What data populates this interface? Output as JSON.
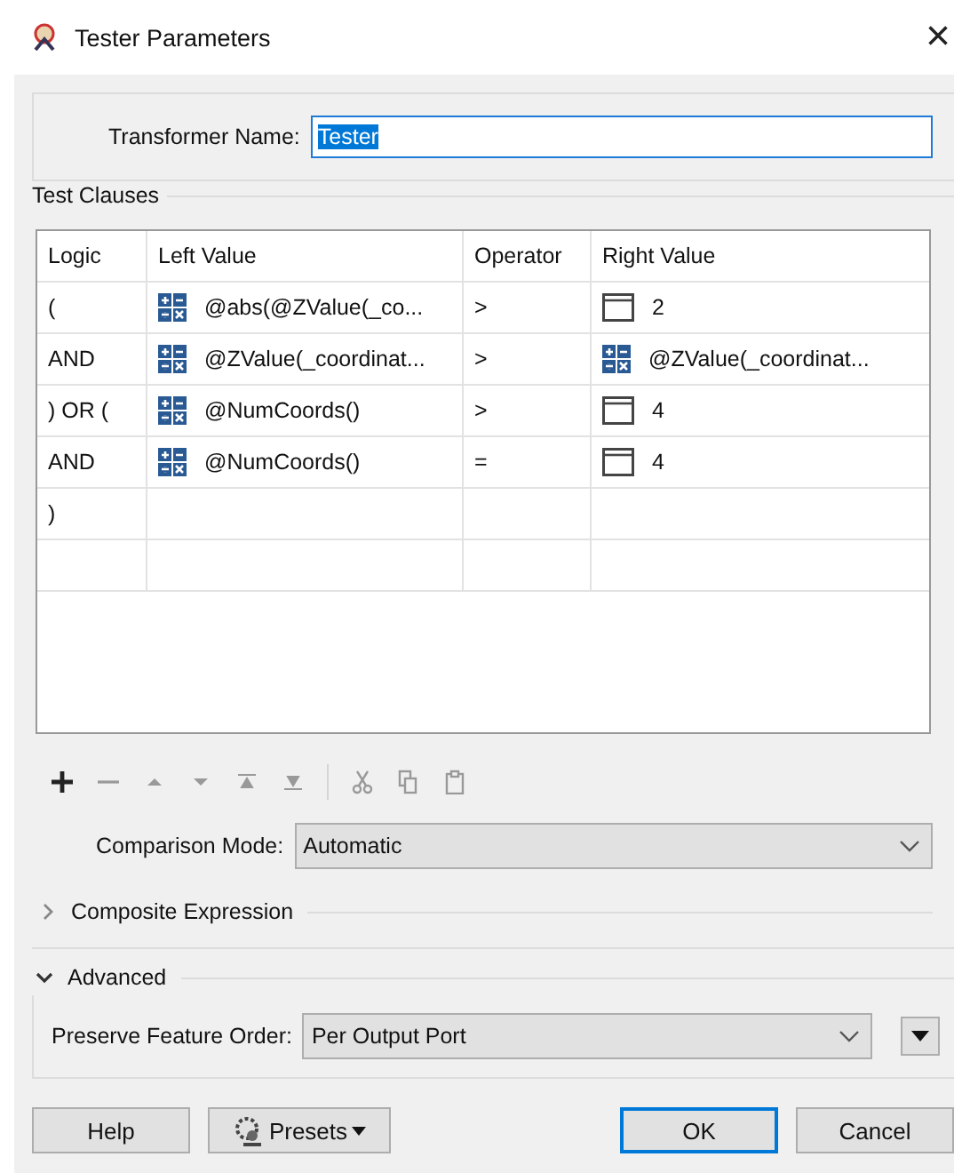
{
  "window": {
    "title": "Tester Parameters",
    "close": "×"
  },
  "transformer_name": {
    "label": "Transformer Name:",
    "value": "Tester",
    "text_selected": true
  },
  "test_clauses": {
    "title": "Test Clauses",
    "columns": [
      "Logic",
      "Left Value",
      "Operator",
      "Right Value"
    ],
    "rows": [
      {
        "logic": "(",
        "left": {
          "kind": "expression",
          "text": "@abs(@ZValue(_co..."
        },
        "operator": ">",
        "right": {
          "kind": "literal",
          "text": "2"
        }
      },
      {
        "logic": "AND",
        "left": {
          "kind": "expression",
          "text": "@ZValue(_coordinat..."
        },
        "operator": ">",
        "right": {
          "kind": "expression",
          "text": "@ZValue(_coordinat..."
        }
      },
      {
        "logic": ") OR (",
        "left": {
          "kind": "expression",
          "text": "@NumCoords()"
        },
        "operator": ">",
        "right": {
          "kind": "literal",
          "text": "4"
        }
      },
      {
        "logic": "AND",
        "left": {
          "kind": "expression",
          "text": "@NumCoords()"
        },
        "operator": "=",
        "right": {
          "kind": "literal",
          "text": "4"
        }
      },
      {
        "logic": ")"
      }
    ],
    "toolbar": [
      {
        "kind": "add",
        "disabled": false
      },
      {
        "kind": "remove",
        "disabled": true
      },
      {
        "kind": "up",
        "disabled": true
      },
      {
        "kind": "down",
        "disabled": true
      },
      {
        "kind": "top",
        "disabled": true
      },
      {
        "kind": "bottom",
        "disabled": true
      },
      {
        "kind": "cut",
        "disabled": true
      },
      {
        "kind": "copy",
        "disabled": true
      },
      {
        "kind": "paste",
        "disabled": true
      }
    ],
    "comparison_mode": {
      "label": "Comparison Mode:",
      "value": "Automatic"
    },
    "composite_expression": {
      "label": "Composite Expression",
      "expanded": false
    }
  },
  "advanced": {
    "label": "Advanced",
    "expanded": true,
    "preserve_feature_order": {
      "label": "Preserve Feature Order:",
      "value": "Per Output Port"
    }
  },
  "buttons": [
    {
      "kind": "help",
      "label": "Help"
    },
    {
      "kind": "presets",
      "label": "Presets"
    },
    {
      "kind": "ok",
      "label": "OK",
      "default": true
    },
    {
      "kind": "cancel",
      "label": "Cancel",
      "default": false
    }
  ]
}
